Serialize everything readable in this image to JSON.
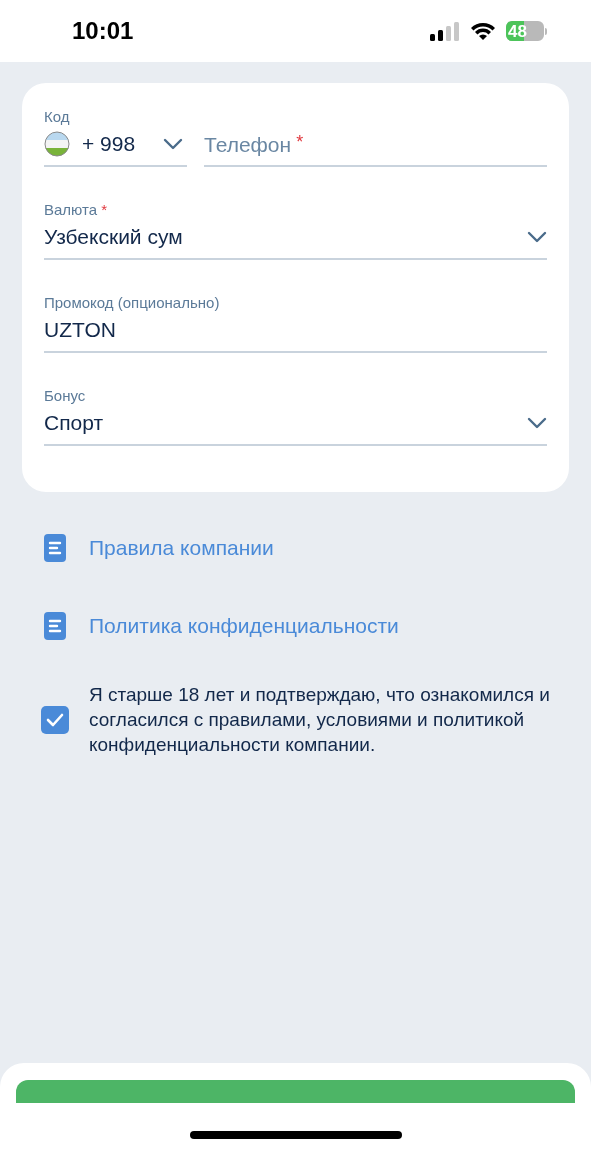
{
  "status_bar": {
    "time": "10:01",
    "battery": "48"
  },
  "phone": {
    "code_label": "Код",
    "code": "+ 998",
    "placeholder": "Телефон",
    "required_mark": "*"
  },
  "fields": [
    {
      "kind": "select",
      "label": "Валюта",
      "required_mark": "*",
      "value": "Узбекский сум"
    },
    {
      "kind": "text",
      "label": "Промокод (опционально)",
      "value": "UZTON"
    },
    {
      "kind": "select",
      "label": "Бонус",
      "value": "Спорт"
    }
  ],
  "links": [
    "Правила компании",
    "Политика конфиденциальности"
  ],
  "consent": {
    "checked": true,
    "text": "Я старше 18 лет и подтверждаю, что ознакомился и согласился с правилами, условиями и политикой конфиденциальности компании."
  }
}
